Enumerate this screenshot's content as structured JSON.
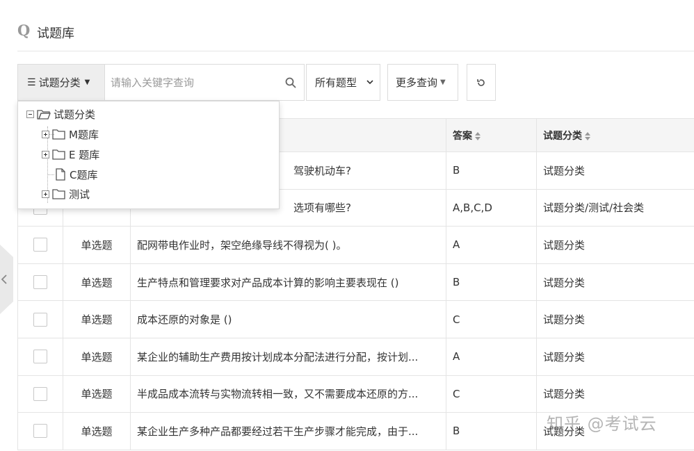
{
  "header": {
    "title": "试题库"
  },
  "toolbar": {
    "category_label": "试题分类",
    "search_placeholder": "请输入关键字查询",
    "type_select_value": "所有题型",
    "more_query_label": "更多查询"
  },
  "tree": {
    "root": "试题分类",
    "children": [
      "M题库",
      "E 题库",
      "C题库",
      "测试"
    ]
  },
  "table": {
    "columns": {
      "answer": "答案",
      "category": "试题分类"
    },
    "rows": [
      {
        "type": "",
        "question": "驾驶机动车?",
        "answer": "B",
        "category": "试题分类"
      },
      {
        "type": "",
        "question": "选项有哪些?",
        "answer": "A,B,C,D",
        "category": "试题分类/测试/社会类"
      },
      {
        "type": "单选题",
        "question": "配网带电作业时，架空绝缘导线不得视为( )。",
        "answer": "A",
        "category": "试题分类"
      },
      {
        "type": "单选题",
        "question": "生产特点和管理要求对产品成本计算的影响主要表现在 ()",
        "answer": "B",
        "category": "试题分类"
      },
      {
        "type": "单选题",
        "question": "成本还原的对象是 ()",
        "answer": "C",
        "category": "试题分类"
      },
      {
        "type": "单选题",
        "question": "某企业的辅助生产费用按计划成本分配法进行分配，按计划...",
        "answer": "A",
        "category": "试题分类"
      },
      {
        "type": "单选题",
        "question": "半成品成本流转与实物流转相一致，又不需要成本还原的方...",
        "answer": "C",
        "category": "试题分类"
      },
      {
        "type": "单选题",
        "question": "某企业生产多种产品都要经过若干生产步骤才能完成，由于...",
        "answer": "B",
        "category": "试题分类"
      }
    ]
  },
  "watermark": "知乎 @考试云"
}
